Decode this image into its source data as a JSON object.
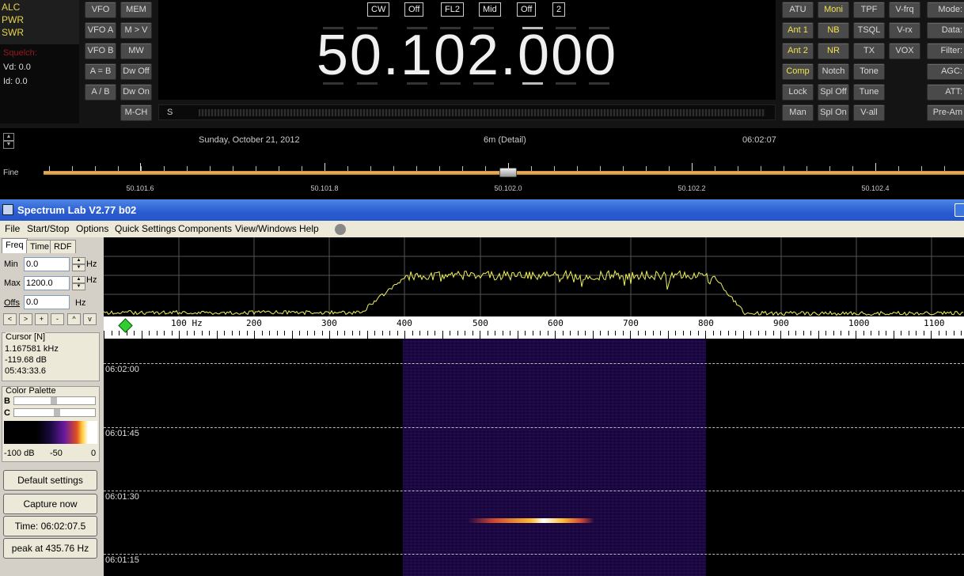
{
  "radio": {
    "meters": {
      "alc": "ALC",
      "pwr": "PWR",
      "swr": "SWR",
      "squelch": "Squelch:",
      "vd": "Vd: 0.0",
      "id": "Id: 0.0"
    },
    "left_buttons": {
      "vfo": "VFO",
      "mem": "MEM",
      "vfoa": "VFO A",
      "mv": "M > V",
      "vfob": "VFO B",
      "mw": "MW",
      "ab_eq": "A = B",
      "dwoff": "Dw Off",
      "ab_sw": "A / B",
      "dwon": "Dw On",
      "mch": "M-CH"
    },
    "tags": [
      "CW",
      "Off",
      "FL2",
      "Mid",
      "Off",
      "2"
    ],
    "frequency": "50.102.000",
    "smeter_label": "S",
    "right_buttons": [
      {
        "label": "ATU",
        "on": false
      },
      {
        "label": "Moni",
        "on": true
      },
      {
        "label": "TPF",
        "on": false
      },
      {
        "label": "V-frq",
        "on": false
      },
      {
        "label": "Ant 1",
        "on": true
      },
      {
        "label": "NB",
        "on": true
      },
      {
        "label": "TSQL",
        "on": false
      },
      {
        "label": "V-rx",
        "on": false
      },
      {
        "label": "Ant 2",
        "on": true
      },
      {
        "label": "NR",
        "on": true
      },
      {
        "label": "TX",
        "on": false
      },
      {
        "label": "VOX",
        "on": false
      },
      {
        "label": "Comp",
        "on": true
      },
      {
        "label": "Notch",
        "on": false
      },
      {
        "label": "Tone",
        "on": false
      },
      {
        "label": "Lock",
        "on": false
      },
      {
        "label": "Spl Off",
        "on": false
      },
      {
        "label": "Tune",
        "on": false
      },
      {
        "label": "Man",
        "on": false
      },
      {
        "label": "Spl On",
        "on": false
      },
      {
        "label": "V-all",
        "on": false
      }
    ],
    "far_right": [
      "Mode:",
      "Data:",
      "Filter:",
      "AGC:",
      "ATT:",
      "Pre-Am"
    ],
    "on_color": "#f2e24c"
  },
  "strip": {
    "date": "Sunday, October 21, 2012",
    "band": "6m (Detail)",
    "time": "06:02:07",
    "fine": "Fine",
    "ticks": [
      "50.101.6",
      "50.101.8",
      "50.102.0",
      "50.102.2",
      "50.102.4"
    ]
  },
  "spectrumlab": {
    "title": "Spectrum Lab V2.77 b02",
    "menu": [
      "File",
      "Start/Stop",
      "Options",
      "Quick Settings",
      "Components",
      "View/Windows",
      "Help"
    ],
    "tabs": [
      "Freq",
      "Time",
      "RDF"
    ],
    "min_label": "Min",
    "min_value": "0.0",
    "max_label": "Max",
    "max_value": "1200.0",
    "offs_label": "Offs",
    "offs_value": "0.0",
    "hz": "Hz",
    "nav": [
      "<",
      ">",
      "+",
      "-",
      "^",
      "v"
    ],
    "cursor_title": "Cursor [N]",
    "cursor_freq": "1.167581 kHz",
    "cursor_db": "-119.68 dB",
    "cursor_time": "05:43:33.6",
    "palette_title": "Color Palette",
    "pal_b": "B",
    "pal_c": "C",
    "pal_min": "-100 dB",
    "pal_mid": "-50",
    "pal_max": "0",
    "default_btn": "Default settings",
    "capture_btn": "Capture now",
    "time_btn": "Time:  06:02:07.5",
    "peak_btn": "peak at 435.76 Hz",
    "freq_scale": [
      "100 Hz",
      "200",
      "300",
      "400",
      "500",
      "600",
      "700",
      "800",
      "900",
      "1000",
      "1100"
    ],
    "time_marks": [
      "06:02:00",
      "06:01:45",
      "06:01:30",
      "06:01:15"
    ]
  }
}
